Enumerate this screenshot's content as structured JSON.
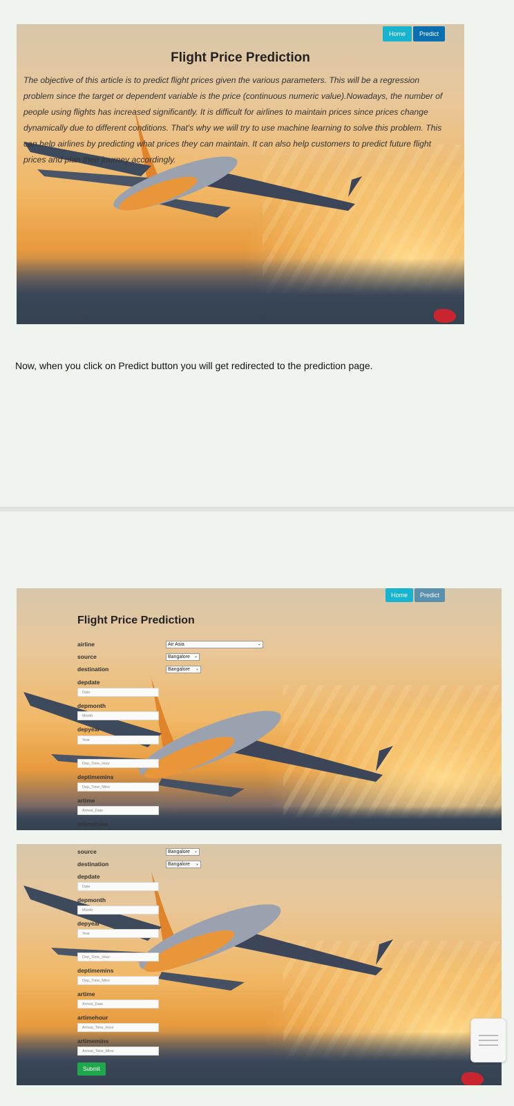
{
  "top": {
    "nav": {
      "home": "Home",
      "predict": "Predict"
    },
    "title": "Flight Price Prediction",
    "paragraph": "The objective of this article is to predict flight prices given the various parameters. This will be a regression problem since the target or dependent variable is the price (continuous numeric value).Nowadays, the number of people using flights has increased significantly. It is difficult for airlines to maintain prices since prices change dynamically due to different conditions. That's why we will try to use machine learning to solve this problem. This can help airlines by predicting what prices they can maintain. It can also help customers to predict future flight prices and plan their journey accordingly."
  },
  "caption": "Now, when you click on Predict button you will get redirected to the prediction page.",
  "form1": {
    "nav": {
      "home": "Home",
      "predict": "Predict"
    },
    "title": "Flight Price Prediction",
    "airline_label": "airline",
    "airline_value": "Air Asia",
    "source_label": "source",
    "source_value": "Bangalore",
    "destination_label": "destination",
    "destination_value": "Bangalore",
    "depdate_label": "depdate",
    "depdate_ph": "Date",
    "depmonth_label": "depmonth",
    "depmonth_ph": "Month",
    "depyear_label": "depyear",
    "depyear_ph": "Year",
    "deptimehour_ph": "Dep_Time_Hour",
    "deptimemins_label": "deptimemins",
    "deptimemins_ph": "Dep_Time_Mins",
    "artime_label": "artime",
    "artime_ph": "Arrival_Date",
    "artimehour_label": "artimehour"
  },
  "form2": {
    "source_label": "source",
    "source_value": "Bangalore",
    "destination_label": "destination",
    "destination_value": "Bangalore",
    "depdate_label": "depdate",
    "depdate_ph": "Date",
    "depmonth_label": "depmonth",
    "depmonth_ph": "Month",
    "depyear_label": "depyear",
    "depyear_ph": "Year",
    "deptimehour_ph": "Dep_Time_Hour",
    "deptimemins_label": "deptimemins",
    "deptimemins_ph": "Dep_Time_Mins",
    "artime_label": "artime",
    "artime_ph": "Arrival_Date",
    "artimehour_label": "artimehour",
    "artimehour_ph": "Arrival_Time_Hour",
    "artimemins_label": "artimemins",
    "artimemins_ph": "Arrival_Time_Mins",
    "submit": "Submit"
  },
  "colors": {
    "home": "#17b3cf",
    "predict": "#0a6fae",
    "submit": "#1fa84b",
    "page_bg": "#eff4ef"
  }
}
